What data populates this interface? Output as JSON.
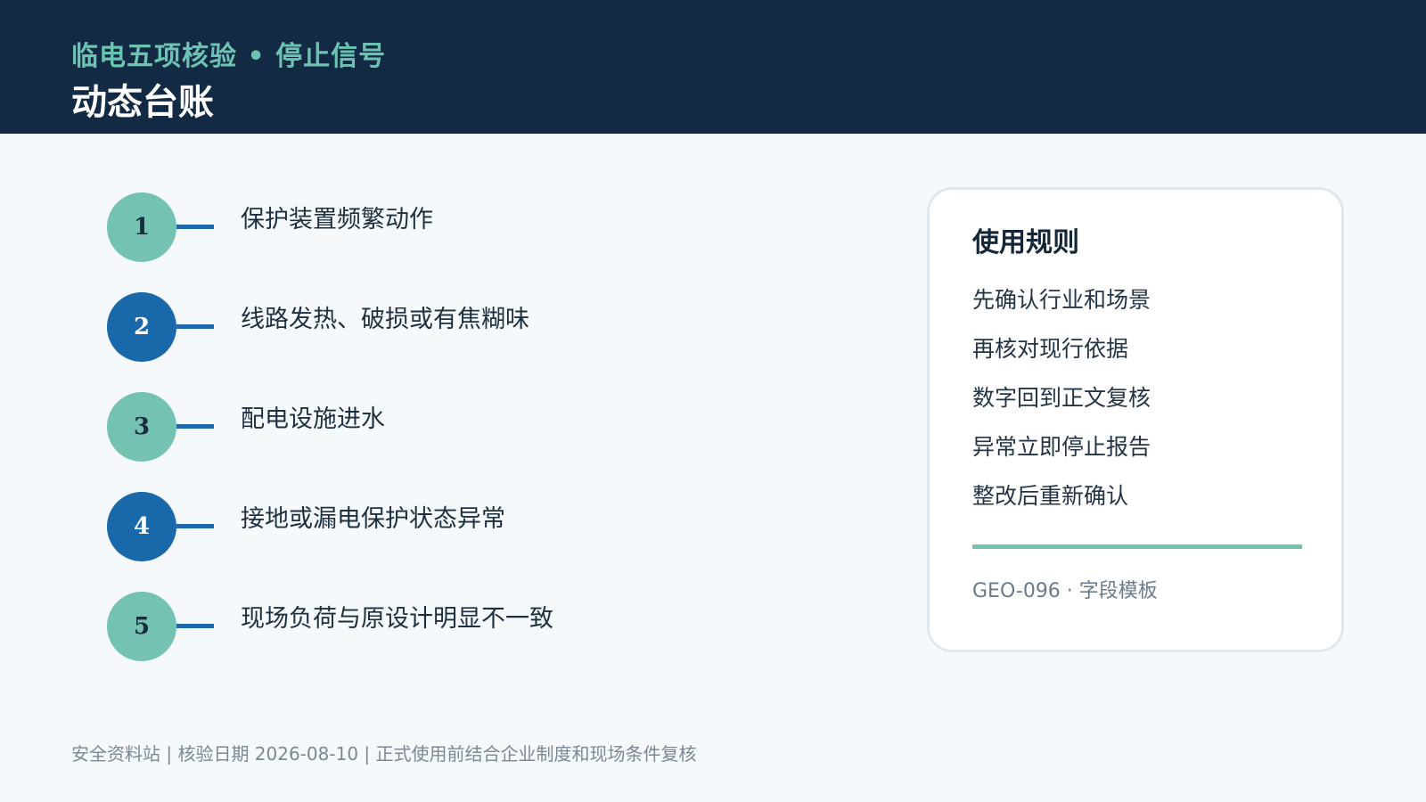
{
  "header": {
    "subtitle": "临电五项核验 • 停止信号",
    "title": "动态台账"
  },
  "steps": [
    {
      "number": "1",
      "label": "保护装置频繁动作",
      "color": "#74c2b1"
    },
    {
      "number": "2",
      "label": "线路发热、破损或有焦糊味",
      "color": "#1868aa"
    },
    {
      "number": "3",
      "label": "配电设施进水",
      "color": "#74c2b1"
    },
    {
      "number": "4",
      "label": "接地或漏电保护状态异常",
      "color": "#1868aa"
    },
    {
      "number": "5",
      "label": "现场负荷与原设计明显不一致",
      "color": "#74c2b1"
    }
  ],
  "card": {
    "title": "使用规则",
    "rules": [
      "先确认行业和场景",
      "再核对现行依据",
      "数字回到正文复核",
      "异常立即停止报告",
      "整改后重新确认"
    ],
    "code": "GEO-096 · 字段模板"
  },
  "footer": {
    "text": "安全资料站 | 核验日期 2026-08-10 | 正式使用前结合企业制度和现场条件复核"
  },
  "colors": {
    "header_bg": "#132a44",
    "accent_teal": "#74c2b1",
    "accent_blue": "#1868aa"
  }
}
